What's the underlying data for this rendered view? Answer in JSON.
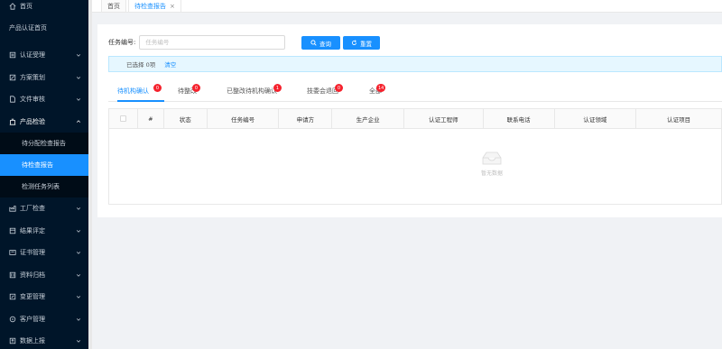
{
  "sidebar": {
    "items": [
      {
        "label": "首页",
        "icon": "home-icon",
        "has_icon": true,
        "chevron": false
      },
      {
        "label": "产品认证首页",
        "icon": "",
        "has_icon": false,
        "chevron": false
      },
      {
        "label": "认证受理",
        "icon": "form-icon",
        "has_icon": true,
        "chevron": true
      },
      {
        "label": "方案策划",
        "icon": "edit-icon",
        "has_icon": true,
        "chevron": true
      },
      {
        "label": "文件审核",
        "icon": "file-icon",
        "has_icon": true,
        "chevron": true
      },
      {
        "label": "产品检验",
        "icon": "inspect-icon",
        "has_icon": true,
        "chevron": true,
        "open": true
      }
    ],
    "submenu": [
      {
        "label": "待分配检查报告"
      },
      {
        "label": "待检查报告",
        "active": true
      },
      {
        "label": "检测任务列表"
      }
    ],
    "items_after": [
      {
        "label": "工厂检查",
        "icon": "factory-icon"
      },
      {
        "label": "结果评定",
        "icon": "result-icon"
      },
      {
        "label": "证书管理",
        "icon": "certificate-icon"
      },
      {
        "label": "资料归档",
        "icon": "archive-icon"
      },
      {
        "label": "变更管理",
        "icon": "change-icon"
      },
      {
        "label": "客户管理",
        "icon": "customer-icon"
      },
      {
        "label": "数据上报",
        "icon": "upload-icon"
      }
    ]
  },
  "tabs": {
    "home": "首页",
    "active": "待检查报告",
    "close": "×"
  },
  "search": {
    "label": "任务编号:",
    "placeholder": "任务编号",
    "query_label": "查询",
    "reset_label": "重置"
  },
  "alert": {
    "selected_text": "已选择 0项",
    "clear_label": "清空"
  },
  "status_tabs": [
    {
      "label": "待机构确认",
      "count": "0",
      "active": true
    },
    {
      "label": "待整改",
      "count": "0"
    },
    {
      "label": "已整改待机构确认",
      "count": "1"
    },
    {
      "label": "技委会退回",
      "count": "0"
    },
    {
      "label": "全部",
      "count": "14"
    }
  ],
  "table": {
    "columns": [
      "#",
      "状态",
      "任务编号",
      "申请方",
      "生产企业",
      "认证工程师",
      "联系电话",
      "认证领域",
      "认证项目"
    ],
    "empty_text": "暂无数据"
  },
  "colors": {
    "sidebar_bg": "#001529",
    "accent": "#1890ff",
    "badge": "#f5222d"
  }
}
